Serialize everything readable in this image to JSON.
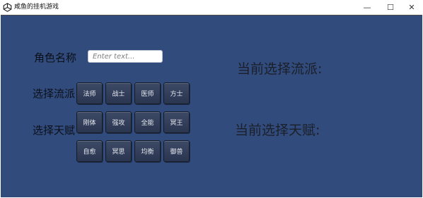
{
  "window": {
    "title": "咸鱼的挂机游戏",
    "minimize": "—",
    "maximize": "☐",
    "close": "✕"
  },
  "form": {
    "name_label": "角色名称",
    "name_placeholder": "Enter text...",
    "school_label": "选择流派",
    "talent_label": "选择天赋"
  },
  "schools": [
    "法师",
    "战士",
    "医师",
    "方士"
  ],
  "talents_row1": [
    "刚体",
    "强攻",
    "全能",
    "冥王"
  ],
  "talents_row2": [
    "自愈",
    "冥思",
    "均衡",
    "御兽"
  ],
  "status": {
    "current_school": "当前选择流派:",
    "current_talent": "当前选择天赋:"
  },
  "colors": {
    "background": "#314c7c",
    "button": "#2f3a55"
  }
}
